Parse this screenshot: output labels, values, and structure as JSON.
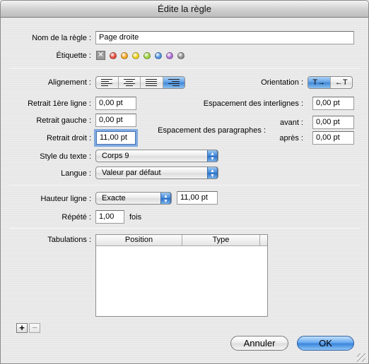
{
  "window": {
    "title": "Édite la règle"
  },
  "rule_name": {
    "label": "Nom de la règle :",
    "value": "Page droite"
  },
  "tag": {
    "label": "Étiquette :",
    "none_icon": "x-icon",
    "colors": [
      "#e84b3c",
      "#f5a623",
      "#f2d21b",
      "#9bd13a",
      "#4a90e2",
      "#b06fd6",
      "#8e8e8e"
    ]
  },
  "alignment": {
    "label": "Alignement :",
    "options": [
      "left-align-icon",
      "center-align-icon",
      "justify-align-icon",
      "right-align-icon"
    ],
    "selected": 3
  },
  "orientation": {
    "label": "Orientation :",
    "ltr": "T→",
    "rtl": "←T",
    "selected": 0
  },
  "indent_first": {
    "label": "Retrait 1ère ligne :",
    "value": "0,00 pt"
  },
  "indent_left": {
    "label": "Retrait gauche :",
    "value": "0,00 pt"
  },
  "indent_right": {
    "label": "Retrait droit :",
    "value": "11,00 pt"
  },
  "line_spacing": {
    "label": "Espacement des interlignes :",
    "value": "0,00 pt"
  },
  "para_spacing": {
    "label": "Espacement des paragraphes :",
    "before_label": "avant :",
    "before_value": "0,00 pt",
    "after_label": "après :",
    "after_value": "0,00 pt"
  },
  "text_style": {
    "label": "Style du texte :",
    "value": "Corps 9"
  },
  "language": {
    "label": "Langue :",
    "value": "Valeur par défaut"
  },
  "line_height": {
    "label": "Hauteur ligne :",
    "mode": "Exacte",
    "value": "11,00 pt"
  },
  "repeat": {
    "label": "Répété :",
    "value": "1,00",
    "unit": "fois"
  },
  "tabs": {
    "label": "Tabulations :",
    "columns": [
      "Position",
      "Type"
    ],
    "rows": []
  },
  "list_controls": {
    "add": "+",
    "remove": "−"
  },
  "buttons": {
    "cancel": "Annuler",
    "ok": "OK"
  }
}
